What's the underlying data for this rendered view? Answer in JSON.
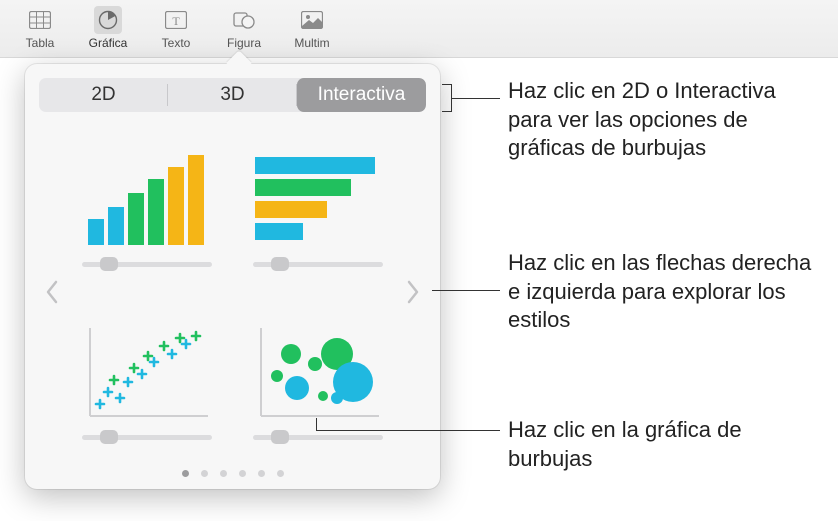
{
  "toolbar": {
    "items": [
      {
        "label": "Tabla",
        "icon": "table-icon"
      },
      {
        "label": "Gráfica",
        "icon": "chart-icon"
      },
      {
        "label": "Texto",
        "icon": "text-icon"
      },
      {
        "label": "Figura",
        "icon": "shape-icon"
      },
      {
        "label": "Multim",
        "icon": "media-icon"
      }
    ]
  },
  "popover": {
    "tabs": {
      "twod": "2D",
      "threed": "3D",
      "interactive": "Interactiva"
    },
    "page_count": 6,
    "active_page": 0,
    "charts": {
      "bar": {
        "name": "interactive-column-chart",
        "colors": [
          "#20b8e0",
          "#20b8e0",
          "#21c05e",
          "#21c05e",
          "#f5b516",
          "#f5b516"
        ]
      },
      "hbar": {
        "name": "interactive-bar-chart",
        "colors": [
          "#20b8e0",
          "#21c05e",
          "#f5b516",
          "#20b8e0"
        ]
      },
      "scatter": {
        "name": "interactive-scatter-chart",
        "colors": [
          "#20b8e0",
          "#21c05e"
        ]
      },
      "bubble": {
        "name": "interactive-bubble-chart",
        "colors": [
          "#20b8e0",
          "#21c05e"
        ]
      }
    }
  },
  "callouts": {
    "tabs": "Haz clic en 2D o Interactiva para ver las opciones de gráficas de burbujas",
    "arrows": "Haz clic en las flechas derecha e izquierda para explorar los estilos",
    "bubble": "Haz clic en la gráfica de burbujas"
  }
}
